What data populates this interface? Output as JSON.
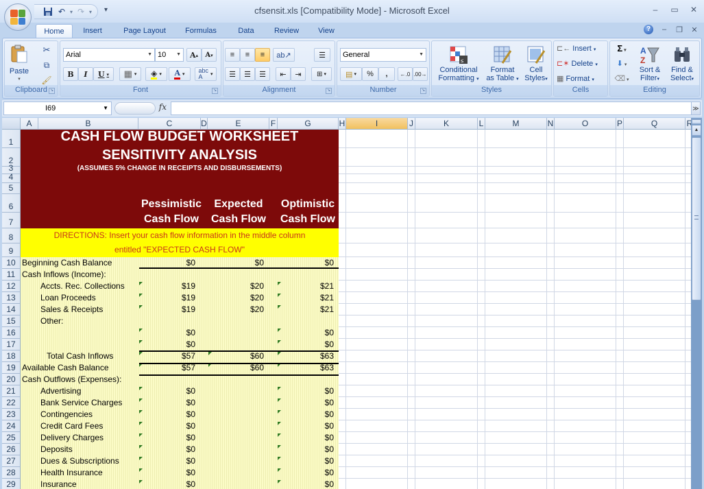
{
  "window": {
    "title": "cfsensit.xls  [Compatibility Mode] - Microsoft Excel",
    "controls": [
      "minimize",
      "maximize",
      "close"
    ]
  },
  "quick_access": {
    "items": [
      "save-icon",
      "undo-icon",
      "redo-icon",
      "customize-icon"
    ]
  },
  "tabs": [
    {
      "label": "Home",
      "active": true
    },
    {
      "label": "Insert"
    },
    {
      "label": "Page Layout"
    },
    {
      "label": "Formulas"
    },
    {
      "label": "Data"
    },
    {
      "label": "Review"
    },
    {
      "label": "View"
    }
  ],
  "ribbon": {
    "clipboard": {
      "label": "Clipboard",
      "paste": "Paste"
    },
    "font": {
      "label": "Font",
      "font_name": "Arial",
      "font_size": "10",
      "bold": "B",
      "italic": "I",
      "underline": "U"
    },
    "alignment": {
      "label": "Alignment"
    },
    "number": {
      "label": "Number",
      "format": "General",
      "percent": "%",
      "comma": ","
    },
    "styles": {
      "label": "Styles",
      "conditional": [
        "Conditional",
        "Formatting"
      ],
      "format_table": [
        "Format",
        "as Table"
      ],
      "cell_styles": [
        "Cell",
        "Styles"
      ]
    },
    "cells": {
      "label": "Cells",
      "insert": "Insert",
      "delete": "Delete",
      "format": "Format"
    },
    "editing": {
      "label": "Editing",
      "sort": [
        "Sort &",
        "Filter"
      ],
      "find": [
        "Find &",
        "Select"
      ],
      "sigma": "Σ"
    }
  },
  "formula_bar": {
    "name_box": "I69",
    "fx": "fx",
    "value": ""
  },
  "columns": [
    "A",
    "B",
    "C",
    "D",
    "E",
    "F",
    "G",
    "H",
    "I",
    "J",
    "K",
    "L",
    "M",
    "N",
    "O",
    "P",
    "Q",
    "R"
  ],
  "selected_column": "I",
  "rows": [
    "1",
    "2",
    "3",
    "4",
    "5",
    "6",
    "7",
    "8",
    "9",
    "10",
    "11",
    "12",
    "13",
    "14",
    "15",
    "16",
    "17",
    "18",
    "19",
    "20",
    "21",
    "22",
    "23",
    "24",
    "25",
    "26",
    "27",
    "28",
    "29"
  ],
  "worksheet": {
    "title1": "CASH FLOW BUDGET WORKSHEET",
    "title2": "SENSITIVITY ANALYSIS",
    "subtitle": "(ASSUMES 5% CHANGE IN RECEIPTS AND DISBURSEMENTS)",
    "col_headers": [
      {
        "line1": "Pessimistic",
        "line2": "Cash Flow"
      },
      {
        "line1": "Expected",
        "line2": "Cash Flow"
      },
      {
        "line1": "Optimistic",
        "line2": "Cash Flow"
      }
    ],
    "directions1": "DIRECTIONS:  Insert your cash flow information in the middle column",
    "directions2": "entitled \"EXPECTED CASH FLOW\"",
    "lines": [
      {
        "row": "10",
        "label": "Beginning Cash Balance",
        "indent": 0,
        "pess": "$0",
        "exp": "$0",
        "opt": "$0"
      },
      {
        "row": "11",
        "label": "Cash Inflows (Income):",
        "indent": 0,
        "pess": "",
        "exp": "",
        "opt": ""
      },
      {
        "row": "12",
        "label": "Accts. Rec. Collections",
        "indent": 1,
        "pess": "$19",
        "exp": "$20",
        "opt": "$21"
      },
      {
        "row": "13",
        "label": "Loan Proceeds",
        "indent": 1,
        "pess": "$19",
        "exp": "$20",
        "opt": "$21"
      },
      {
        "row": "14",
        "label": "Sales & Receipts",
        "indent": 1,
        "pess": "$19",
        "exp": "$20",
        "opt": "$21"
      },
      {
        "row": "15",
        "label": "Other:",
        "indent": 1,
        "pess": "",
        "exp": "",
        "opt": ""
      },
      {
        "row": "16",
        "label": "",
        "indent": 1,
        "pess": "$0",
        "exp": "",
        "opt": "$0"
      },
      {
        "row": "17",
        "label": "",
        "indent": 1,
        "pess": "$0",
        "exp": "",
        "opt": "$0"
      },
      {
        "row": "18",
        "label": "Total Cash Inflows",
        "indent": 2,
        "pess": "$57",
        "exp": "$60",
        "opt": "$63"
      },
      {
        "row": "19",
        "label": "Available Cash Balance",
        "indent": 0,
        "pess": "$57",
        "exp": "$60",
        "opt": "$63"
      },
      {
        "row": "20",
        "label": "Cash Outflows (Expenses):",
        "indent": 0,
        "pess": "",
        "exp": "",
        "opt": ""
      },
      {
        "row": "21",
        "label": "Advertising",
        "indent": 1,
        "pess": "$0",
        "exp": "",
        "opt": "$0"
      },
      {
        "row": "22",
        "label": "Bank Service Charges",
        "indent": 1,
        "pess": "$0",
        "exp": "",
        "opt": "$0"
      },
      {
        "row": "23",
        "label": "Contingencies",
        "indent": 1,
        "pess": "$0",
        "exp": "",
        "opt": "$0"
      },
      {
        "row": "24",
        "label": "Credit Card Fees",
        "indent": 1,
        "pess": "$0",
        "exp": "",
        "opt": "$0"
      },
      {
        "row": "25",
        "label": "Delivery Charges",
        "indent": 1,
        "pess": "$0",
        "exp": "",
        "opt": "$0"
      },
      {
        "row": "26",
        "label": "Deposits",
        "indent": 1,
        "pess": "$0",
        "exp": "",
        "opt": "$0"
      },
      {
        "row": "27",
        "label": "Dues & Subscriptions",
        "indent": 1,
        "pess": "$0",
        "exp": "",
        "opt": "$0"
      },
      {
        "row": "28",
        "label": "Health Insurance",
        "indent": 1,
        "pess": "$0",
        "exp": "",
        "opt": "$0"
      },
      {
        "row": "29",
        "label": "Insurance",
        "indent": 1,
        "pess": "$0",
        "exp": "",
        "opt": "$0"
      }
    ]
  },
  "colors": {
    "maroon": "#7d0a0a",
    "yellow": "#ffff00",
    "cream": "#fbfbc6",
    "directions_text": "#c8361a",
    "selected_header": "#f1c15f"
  }
}
